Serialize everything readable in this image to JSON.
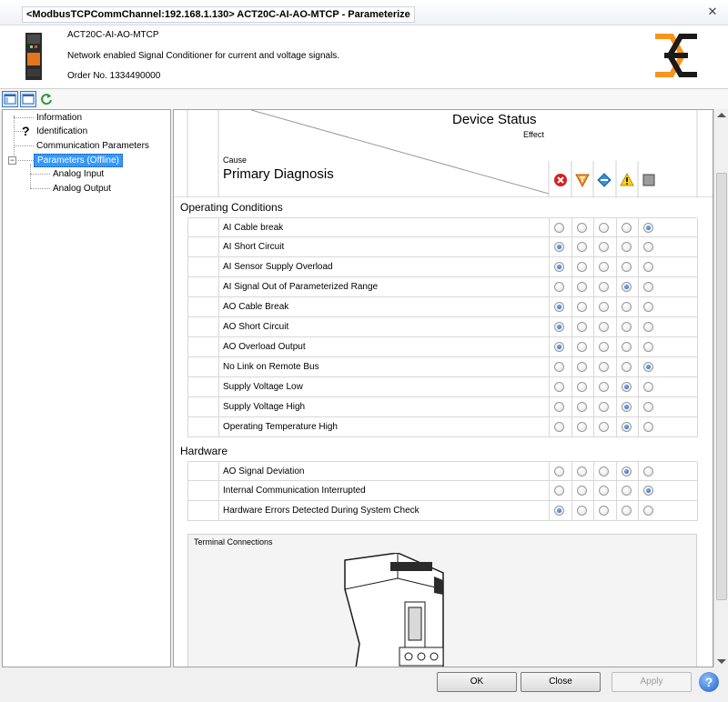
{
  "window": {
    "title": "<ModbusTCPCommChannel:192.168.1.130> ACT20C-AI-AO-MTCP - Parameterize",
    "close_glyph": "✕"
  },
  "header": {
    "product": "ACT20C-AI-AO-MTCP",
    "description": "Network enabled Signal Conditioner for current and voltage signals.",
    "order": "Order No. 1334490000",
    "brand_colors": [
      "#f7941d",
      "#1a1a1a"
    ]
  },
  "tree": {
    "items": [
      {
        "label": "Information"
      },
      {
        "label": "Identification"
      },
      {
        "label": "Communication Parameters"
      },
      {
        "label": "Parameters (Offline)",
        "selected": true
      },
      {
        "label": "Analog Input"
      },
      {
        "label": "Analog Output"
      }
    ],
    "help_glyph": "?"
  },
  "matrix": {
    "title": "Device Status",
    "effect_label": "Effect",
    "cause_label": "Cause",
    "primary_label": "Primary Diagnosis",
    "effect_icons": [
      "failure-icon",
      "function-check-icon",
      "maintenance-icon",
      "out-of-spec-icon",
      "no-effect-icon"
    ],
    "sections": [
      {
        "title": "Operating Conditions",
        "rows": [
          {
            "label": "AI Cable break",
            "selected": 4
          },
          {
            "label": "AI Short Circuit",
            "selected": 0
          },
          {
            "label": "AI Sensor Supply Overload",
            "selected": 0
          },
          {
            "label": "AI Signal Out of Parameterized Range",
            "selected": 3
          },
          {
            "label": "AO Cable Break",
            "selected": 0
          },
          {
            "label": "AO Short Circuit",
            "selected": 0
          },
          {
            "label": "AO Overload Output",
            "selected": 0
          },
          {
            "label": "No Link on Remote Bus",
            "selected": 4
          },
          {
            "label": "Supply Voltage Low",
            "selected": 3
          },
          {
            "label": "Supply Voltage High",
            "selected": 3
          },
          {
            "label": "Operating Temperature High",
            "selected": 3
          }
        ]
      },
      {
        "title": "Hardware",
        "rows": [
          {
            "label": "AO Signal Deviation",
            "selected": 3
          },
          {
            "label": "Internal Communication Interrupted",
            "selected": 4
          },
          {
            "label": "Hardware Errors Detected During System Check",
            "selected": 0
          }
        ]
      }
    ]
  },
  "terminal": {
    "label": "Terminal Connections"
  },
  "footer": {
    "ok": "OK",
    "close": "Close",
    "apply": "Apply",
    "help": "?"
  }
}
